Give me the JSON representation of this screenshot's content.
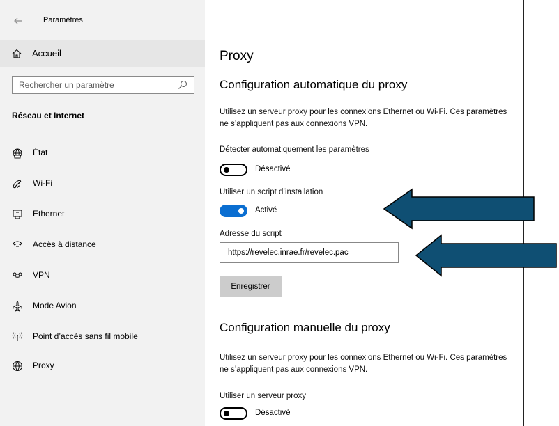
{
  "window": {
    "title": "Paramètres"
  },
  "sidebar": {
    "home_label": "Accueil",
    "search_placeholder": "Rechercher un paramètre",
    "section_title": "Réseau et Internet",
    "items": [
      {
        "label": "État",
        "icon": "globe-status-icon"
      },
      {
        "label": "Wi-Fi",
        "icon": "wifi-icon"
      },
      {
        "label": "Ethernet",
        "icon": "ethernet-icon"
      },
      {
        "label": "Accès à distance",
        "icon": "dialup-icon"
      },
      {
        "label": "VPN",
        "icon": "vpn-icon"
      },
      {
        "label": "Mode Avion",
        "icon": "airplane-icon"
      },
      {
        "label": "Point d’accès sans fil mobile",
        "icon": "hotspot-icon"
      },
      {
        "label": "Proxy",
        "icon": "globe-icon"
      }
    ]
  },
  "main": {
    "page_title": "Proxy",
    "auto": {
      "heading": "Configuration automatique du proxy",
      "description": "Utilisez un serveur proxy pour les connexions Ethernet ou Wi-Fi. Ces paramètres ne s’appliquent pas aux connexions VPN.",
      "detect_label": "Détecter automatiquement les paramètres",
      "detect_state": "Désactivé",
      "script_label": "Utiliser un script d’installation",
      "script_state": "Activé",
      "address_label": "Adresse du script",
      "address_value": "https://revelec.inrae.fr/revelec.pac",
      "save_label": "Enregistrer"
    },
    "manual": {
      "heading": "Configuration manuelle du proxy",
      "description": "Utilisez un serveur proxy pour les connexions Ethernet ou Wi-Fi. Ces paramètres ne s’appliquent pas aux connexions VPN.",
      "proxy_label": "Utiliser un serveur proxy",
      "proxy_state": "Désactivé"
    }
  },
  "colors": {
    "toggle_on": "#0a6ed1",
    "arrow_fill": "#0f4f73",
    "sidebar_bg": "#f2f2f2"
  }
}
